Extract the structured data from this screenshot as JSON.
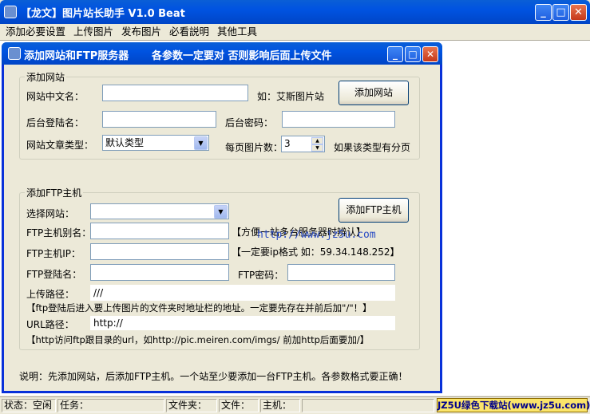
{
  "window": {
    "title": "【龙文】图片站长助手 V1.0 Beat",
    "controls": [
      "_",
      "□",
      "✕"
    ]
  },
  "menu": [
    "添加必要设置",
    "上传图片",
    "发布图片",
    "必看説明",
    "其他工具"
  ],
  "dialog": {
    "title": "添加网站和FTP服务器",
    "title_note": "各参数一定要对  否则影响后面上传文件",
    "controls": [
      "_",
      "□",
      "✕"
    ],
    "site_group": {
      "legend": "添加网站",
      "name_label": "网站中文名：",
      "name_value": "",
      "name_hint": "如：艾斯图片站",
      "add_site_button": "添加网站",
      "login_label": "后台登陆名：",
      "login_value": "",
      "password_label": "后台密码：",
      "password_value": "",
      "type_label": "网站文章类型：",
      "type_value": "默认类型",
      "per_page_label": "每页图片数：",
      "per_page_value": "3",
      "per_page_hint": "如果该类型有分页"
    },
    "ftp_group": {
      "legend": "添加FTP主机",
      "select_site_label": "选择网站：",
      "select_site_value": "",
      "add_ftp_button": "添加FTP主机",
      "alias_label": "FTP主机别名：",
      "alias_value": "",
      "alias_hint": "【方便一站多台服务器时辨认】",
      "ip_label": "FTP主机IP：",
      "ip_value": "",
      "ip_hint": "【一定要ip格式  如：59.34.148.252】",
      "login_label": "FTP登陆名：",
      "login_value": "",
      "password_label": "FTP密码：",
      "password_value": "",
      "path_label": "上传路径：",
      "path_value": "///",
      "path_hint": "【ftp登陆后进入要上传图片的文件夹时地址栏的地址。一定要先存在并前后加\"/\"！】",
      "url_label": "URL路径：",
      "url_value": "http://",
      "url_hint": "【http访问ftp跟目录的url，如http://pic.meiren.com/imgs/  前加http后面要加/】"
    },
    "watermark": "http://www.jz5u.com",
    "footer_note": "说明：先添加网站，后添加FTP主机。一个站至少要添加一台FTP主机。各参数格式要正确！"
  },
  "status": {
    "state": "状态：空闲",
    "task": "任务：",
    "folder": "文件夹：",
    "file": "文件：",
    "host": "主机：",
    "badge": "JZ5U绿色下载站(www.jz5u.com)"
  }
}
